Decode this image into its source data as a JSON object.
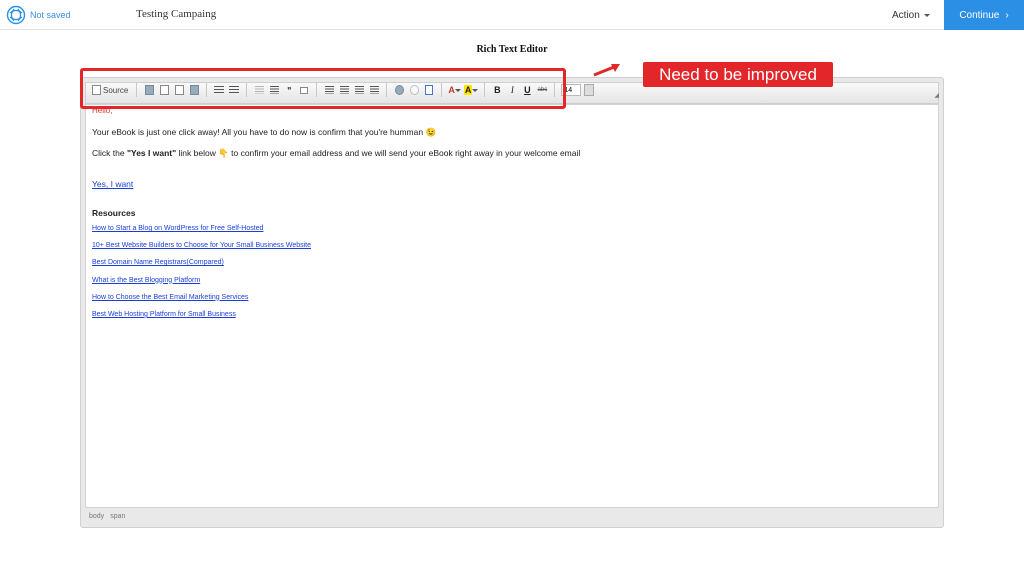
{
  "header": {
    "save_status": "Not saved",
    "campaign_title": "Testing Campaing",
    "action_label": "Action",
    "continue_label": "Continue",
    "continue_arrow": "›"
  },
  "page": {
    "heading": "Rich Text Editor"
  },
  "annotation": {
    "text": "Need to be improved",
    "color": "#e3262a"
  },
  "toolbar": {
    "source_label": "Source",
    "quote_glyph": "❞",
    "bold": "B",
    "italic": "I",
    "underline": "U",
    "strike": "abc",
    "font_color_glyph": "A",
    "bg_color_glyph": "A",
    "font_size": "14"
  },
  "content": {
    "greeting": "Hello,",
    "paragraph1": "Your eBook is just one click away! All you have to do now is confirm that you're humman 😉",
    "p2_before": "Click the ",
    "p2_bold": "\"Yes I want\"",
    "p2_after": " link below 👇 to confirm your email address and we will send your eBook right away in your welcome email",
    "cta_link": "Yes, I want",
    "resources_heading": "Resources",
    "resources": [
      "How to Start a Blog on WordPress for Free Self-Hosted",
      "10+ Best Website Builders to Choose for Your Small Business Website",
      "Best Domain Name Registrars(Compared)",
      "What is the Best Blogging Platform",
      "How to Choose the Best Email Marketing Services",
      "Best Web Hosting Platform for Small Business"
    ]
  },
  "statusbar": {
    "path": [
      "body",
      "span"
    ]
  },
  "colors": {
    "accent": "#2b8fe6",
    "link": "#1a3ed9",
    "annotation": "#e3262a"
  }
}
